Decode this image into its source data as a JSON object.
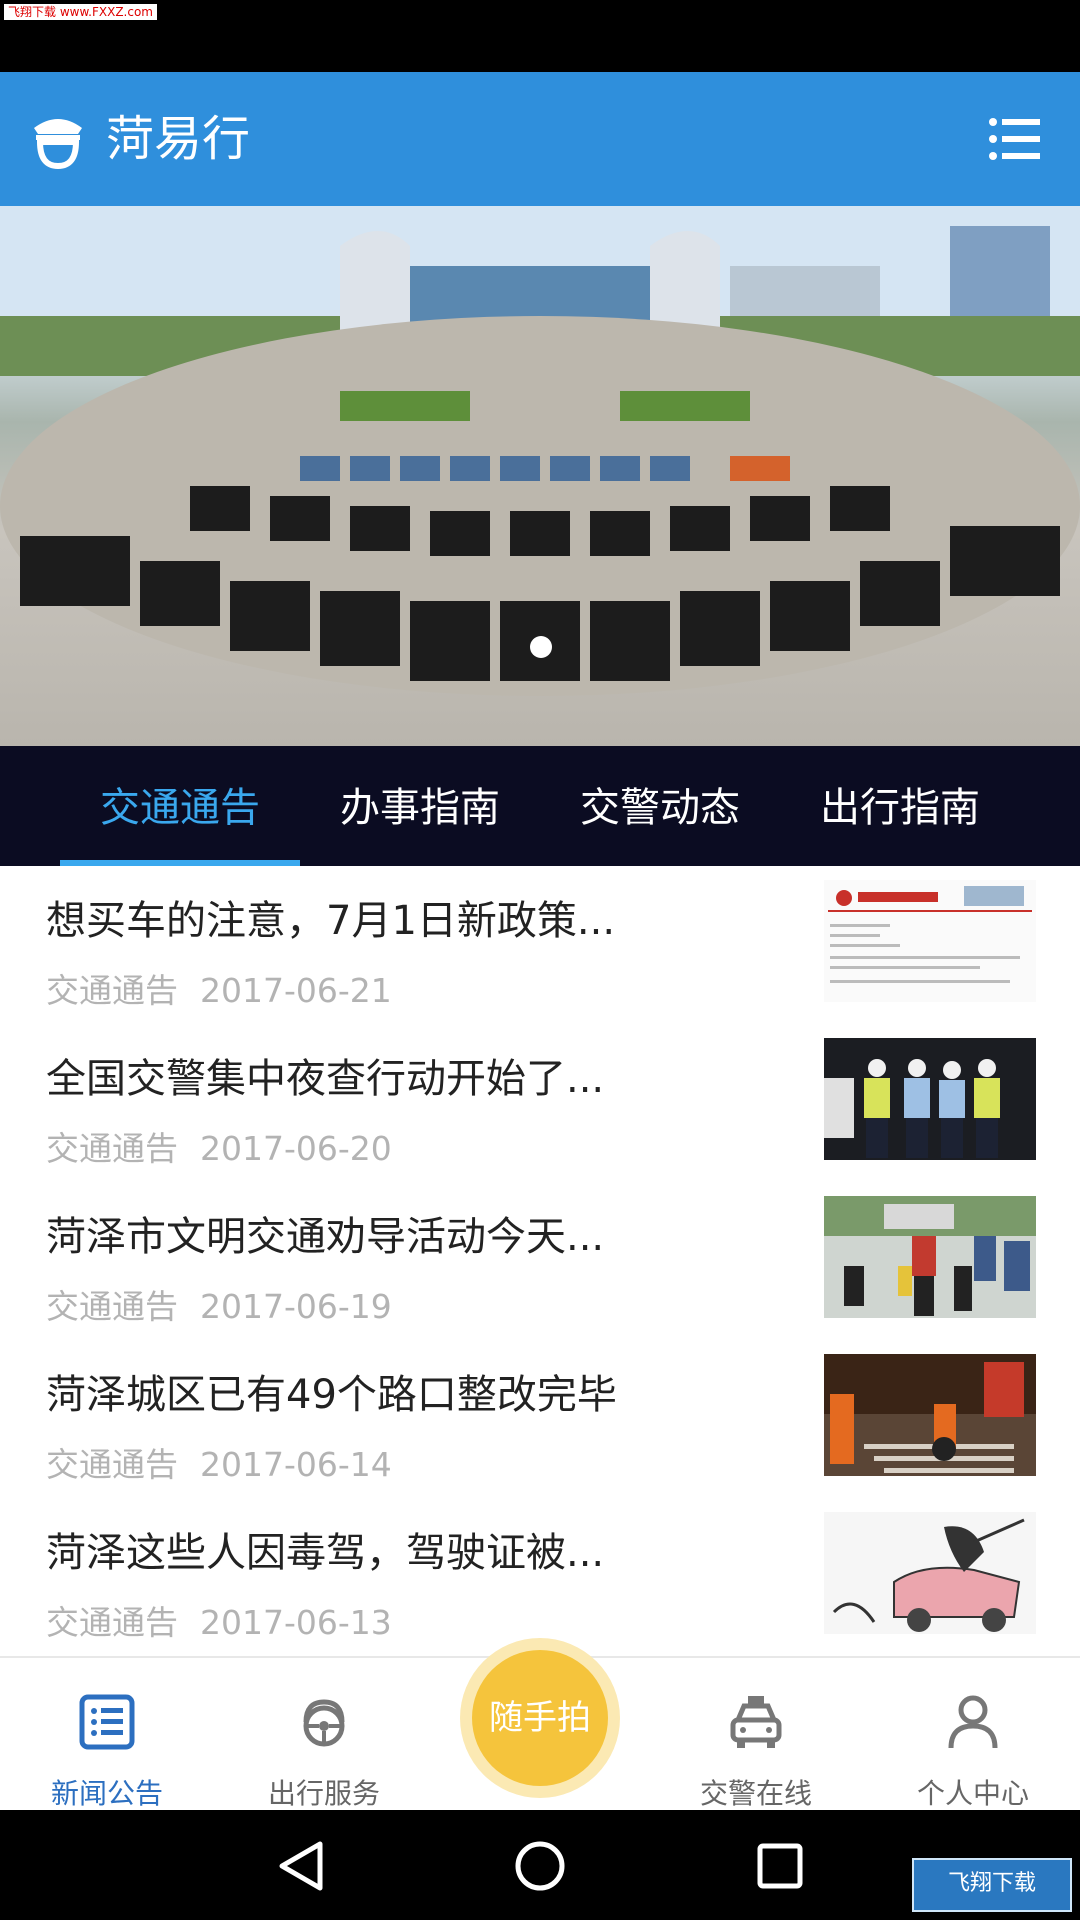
{
  "watermark": "飞翔下载 www.FXXZ.com",
  "header": {
    "title": "菏易行"
  },
  "colors": {
    "header": "#2f8fdc",
    "tab_bar": "#0b0c22",
    "tab_active": "#3aa8ee",
    "snap_button": "#f5c43c",
    "nav_active": "#2c6fc0"
  },
  "banner": {
    "slides_dot": "active"
  },
  "tabs": [
    {
      "label": "交通通告",
      "active": true
    },
    {
      "label": "办事指南",
      "active": false
    },
    {
      "label": "交警动态",
      "active": false
    },
    {
      "label": "出行指南",
      "active": false
    }
  ],
  "news": [
    {
      "title": "想买车的注意，7月1日新政策...",
      "category": "交通通告",
      "date": "2017-06-21"
    },
    {
      "title": "全国交警集中夜查行动开始了...",
      "category": "交通通告",
      "date": "2017-06-20"
    },
    {
      "title": "菏泽市文明交通劝导活动今天...",
      "category": "交通通告",
      "date": "2017-06-19"
    },
    {
      "title": "菏泽城区已有49个路口整改完毕",
      "category": "交通通告",
      "date": "2017-06-14"
    },
    {
      "title": "菏泽这些人因毒驾，驾驶证被...",
      "category": "交通通告",
      "date": "2017-06-13"
    }
  ],
  "bottom_nav": {
    "items": [
      {
        "label": "新闻公告",
        "icon": "list-icon",
        "active": true
      },
      {
        "label": "出行服务",
        "icon": "steering-wheel-icon",
        "active": false
      },
      {
        "label": "交警在线",
        "icon": "police-car-icon",
        "active": false
      },
      {
        "label": "个人中心",
        "icon": "person-icon",
        "active": false
      }
    ],
    "snap_label": "随手拍"
  },
  "brand_badge": "飞翔下载"
}
